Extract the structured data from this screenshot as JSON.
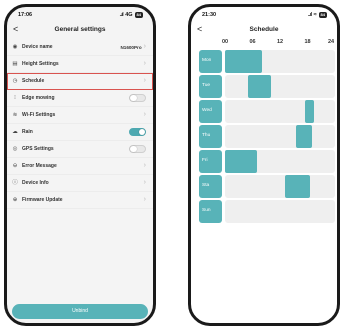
{
  "left": {
    "status": {
      "time": "17:06",
      "signal": "..ıl",
      "network": "4G",
      "battery": "84"
    },
    "nav": {
      "back": "<",
      "title": "General settings"
    },
    "rows": [
      {
        "name": "device-name",
        "icon": "device-icon",
        "glyph": "◉",
        "label": "Device name",
        "value": "N1600Pro",
        "control": "chevron"
      },
      {
        "name": "height-settings",
        "icon": "height-icon",
        "glyph": "▤",
        "label": "Height Settings",
        "control": "chevron"
      },
      {
        "name": "schedule",
        "icon": "clock-icon",
        "glyph": "◷",
        "label": "Schedule",
        "control": "chevron",
        "highlight": true
      },
      {
        "name": "edge-mowing",
        "icon": "edge-icon",
        "glyph": "⁝",
        "label": "Edge mowing",
        "control": "toggle",
        "on": false
      },
      {
        "name": "wifi-settings",
        "icon": "wifi-icon",
        "glyph": "≋",
        "label": "Wi-Fi Settings",
        "control": "chevron"
      },
      {
        "name": "rain",
        "icon": "rain-icon",
        "glyph": "☁",
        "label": "Rain",
        "control": "toggle",
        "on": true
      },
      {
        "name": "gps-settings",
        "icon": "gps-icon",
        "glyph": "◎",
        "label": "GPS Settings",
        "control": "toggle",
        "on": false
      },
      {
        "name": "error-message",
        "icon": "error-icon",
        "glyph": "⊖",
        "label": "Error Message",
        "control": "chevron"
      },
      {
        "name": "device-info",
        "icon": "info-icon",
        "glyph": "ⓘ",
        "label": "Device Info",
        "control": "chevron"
      },
      {
        "name": "firmware-update",
        "icon": "update-icon",
        "glyph": "⊕",
        "label": "Firmware Update",
        "control": "chevron"
      }
    ],
    "unbind_label": "Unbind"
  },
  "right": {
    "status": {
      "time": "21:30",
      "signal": "..ıl",
      "wifi": "≈",
      "battery": "84"
    },
    "nav": {
      "back": "<",
      "title": "Schedule"
    },
    "hours": [
      "00",
      "06",
      "12",
      "18",
      "24"
    ],
    "days": [
      {
        "label": "Mon",
        "blocks": [
          [
            0,
            8
          ]
        ]
      },
      {
        "label": "Tue",
        "blocks": [
          [
            5,
            10
          ]
        ]
      },
      {
        "label": "Wed",
        "blocks": [
          [
            17.5,
            19.5
          ]
        ]
      },
      {
        "label": "Thu",
        "blocks": [
          [
            15.5,
            19
          ]
        ]
      },
      {
        "label": "Fri",
        "blocks": [
          [
            0,
            7
          ]
        ]
      },
      {
        "label": "Sta",
        "blocks": [
          [
            13,
            18.5
          ]
        ]
      },
      {
        "label": "Sun",
        "blocks": []
      }
    ],
    "colors": {
      "accent": "#58b3b8",
      "track": "#efefef"
    }
  }
}
